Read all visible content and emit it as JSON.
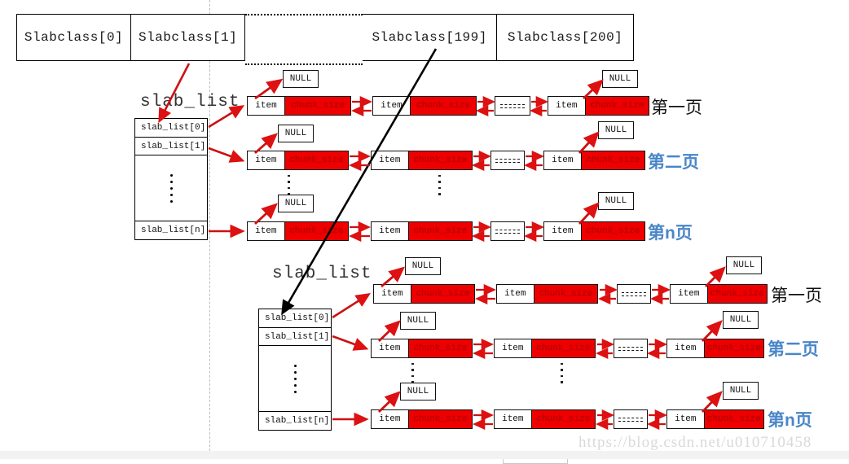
{
  "slabclass_table": {
    "cells": [
      {
        "label": "Slabclass[0]",
        "style": "solid"
      },
      {
        "label": "Slabclass[1]",
        "style": "solid"
      },
      {
        "label": "",
        "style": "dotted"
      },
      {
        "label": "Slabclass[199]",
        "style": "solid"
      },
      {
        "label": "Slabclass[200]",
        "style": "solid"
      }
    ]
  },
  "colors": {
    "chunk_red": "#ee0000",
    "arrow_red": "#dd1111",
    "page_blue": "#4a86c8",
    "outline_black": "#111111",
    "separator_gray": "#bdbdbd",
    "watermark_gray": "#d9d9d9"
  },
  "node_text": {
    "item": "item",
    "chunk_size": "chunk_size",
    "null": "NULL",
    "ellipsis": "-------"
  },
  "groups": [
    {
      "id": "upper",
      "title": "slab_list",
      "table_rows": [
        {
          "label": "slab_list[0]",
          "kind": "entry"
        },
        {
          "label": "slab_list[1]",
          "kind": "entry"
        },
        {
          "label": "",
          "kind": "dots"
        },
        {
          "label": "slab_list[n]",
          "kind": "entry"
        }
      ],
      "chains": [
        {
          "page_label": "第一页",
          "page_label_color": "black",
          "nodes": [
            "item",
            "item",
            "ellipsis",
            "item"
          ],
          "null_count": 2
        },
        {
          "page_label": "第二页",
          "page_label_color": "blue",
          "nodes": [
            "item",
            "item",
            "ellipsis",
            "item"
          ],
          "null_count": 2
        },
        {
          "page_label": "第n页",
          "page_label_color": "blue",
          "nodes": [
            "item",
            "item",
            "ellipsis",
            "item"
          ],
          "null_count": 2
        }
      ]
    },
    {
      "id": "lower",
      "title": "slab_list",
      "table_rows": [
        {
          "label": "slab_list[0]",
          "kind": "entry"
        },
        {
          "label": "slab_list[1]",
          "kind": "entry"
        },
        {
          "label": "",
          "kind": "dots"
        },
        {
          "label": "slab_list[n]",
          "kind": "entry"
        }
      ],
      "chains": [
        {
          "page_label": "第一页",
          "page_label_color": "black",
          "nodes": [
            "item",
            "item",
            "ellipsis",
            "item"
          ],
          "null_count": 2
        },
        {
          "page_label": "第二页",
          "page_label_color": "blue",
          "nodes": [
            "item",
            "item",
            "ellipsis",
            "item"
          ],
          "null_count": 2
        },
        {
          "page_label": "第n页",
          "page_label_color": "blue",
          "nodes": [
            "item",
            "item",
            "ellipsis",
            "item"
          ],
          "null_count": 2
        }
      ]
    }
  ],
  "watermark": "https://blog.csdn.net/u010710458"
}
